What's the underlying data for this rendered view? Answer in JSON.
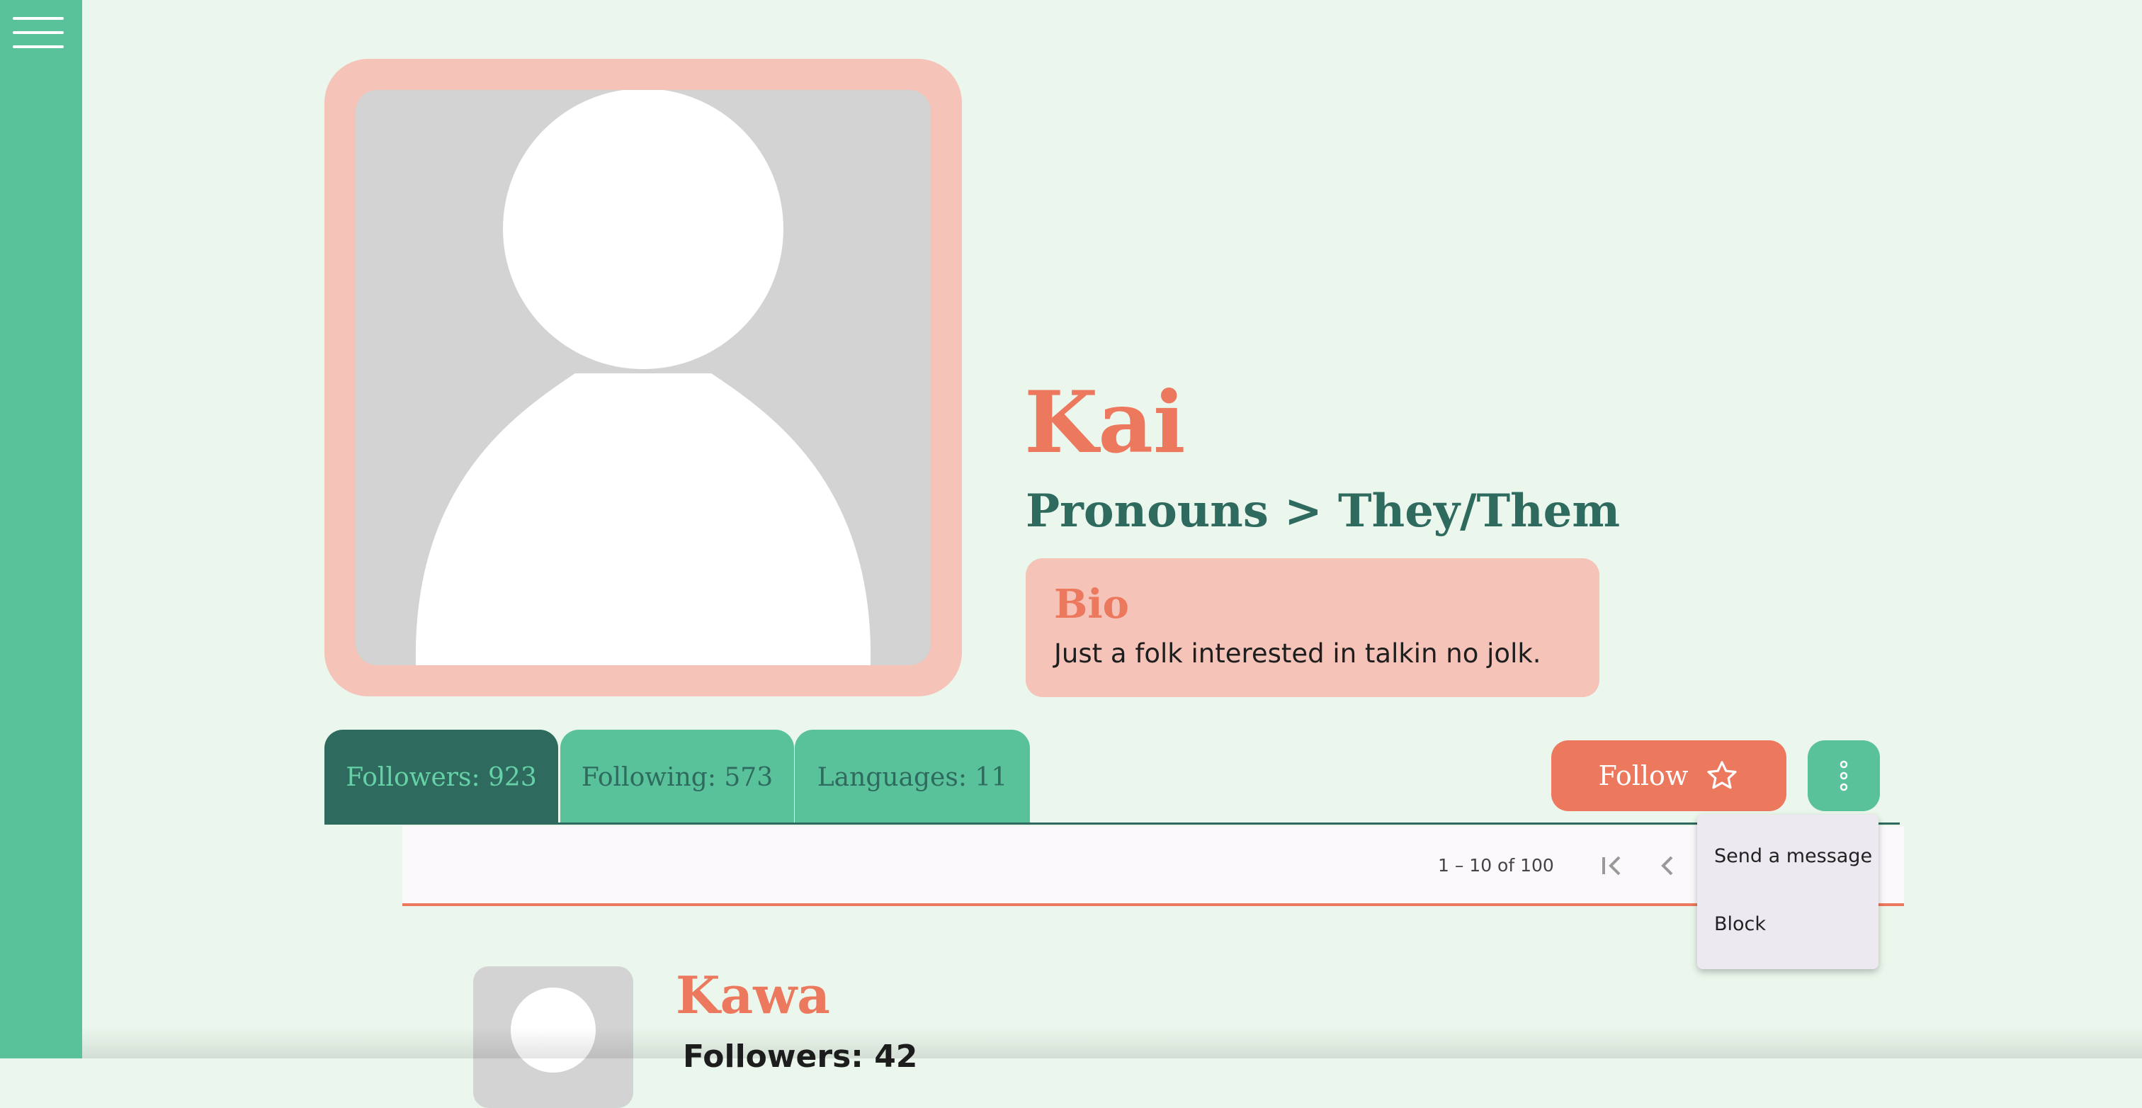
{
  "profile": {
    "name": "Kai",
    "pronouns": "Pronouns > They/Them",
    "bio_title": "Bio",
    "bio_text": "Just a folk interested in talkin no jolk."
  },
  "tabs": [
    {
      "label": "Followers: 923",
      "active": true
    },
    {
      "label": "Following: 573",
      "active": false
    },
    {
      "label": "Languages: 11",
      "active": false
    }
  ],
  "actions": {
    "follow_label": "Follow"
  },
  "paginator": {
    "range_label": "1 – 10 of 100"
  },
  "more_menu": {
    "items": [
      "Send a message",
      "Block"
    ]
  },
  "list": {
    "items": [
      {
        "name": "Kawa",
        "followers": "Followers: 42"
      }
    ]
  },
  "colors": {
    "background": "#ebf7ec",
    "sidebar": "#5ac29b",
    "accent": "#ec785e",
    "accent_light": "#f5c3b7",
    "dark_green": "#2e6a5e"
  },
  "icons": {
    "menu": "hamburger-menu-icon",
    "follow": "star-outline-icon",
    "more": "more-vertical-icon",
    "first_page": "first-page-icon",
    "prev_page": "chevron-left-icon"
  }
}
